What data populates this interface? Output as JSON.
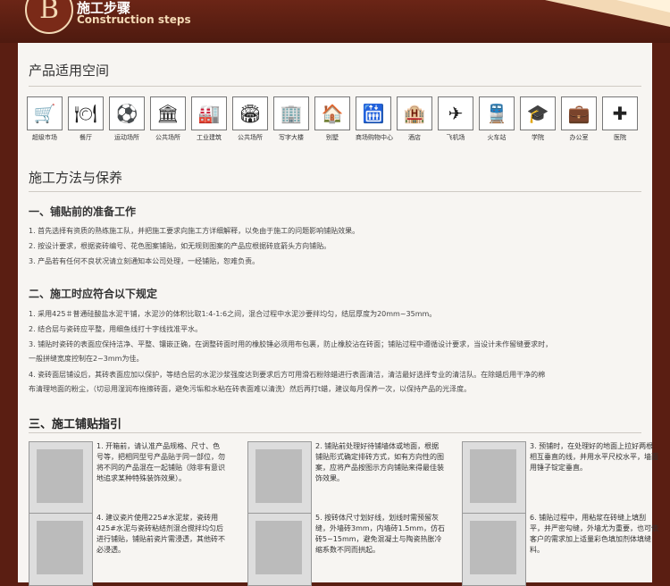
{
  "header": {
    "badge": "B",
    "title": "施工步骤",
    "subtitle": "Construction steps"
  },
  "section1": {
    "title": "产品适用空间"
  },
  "icons": [
    {
      "label": "超级市场",
      "icon": "cart-icon",
      "glyph": "🛒"
    },
    {
      "label": "餐厅",
      "icon": "restaurant-icon",
      "glyph": "🍽"
    },
    {
      "label": "运动场所",
      "icon": "sports-icon",
      "glyph": "⚽"
    },
    {
      "label": "公共场所",
      "icon": "public-building-icon",
      "glyph": "🏛"
    },
    {
      "label": "工业建筑",
      "icon": "factory-icon",
      "glyph": "🏭"
    },
    {
      "label": "公共场所",
      "icon": "stadium-icon",
      "glyph": "🏟"
    },
    {
      "label": "写字大楼",
      "icon": "office-tower-icon",
      "glyph": "🏢"
    },
    {
      "label": "别墅",
      "icon": "villa-icon",
      "glyph": "🏠"
    },
    {
      "label": "商场购物中心",
      "icon": "escalator-icon",
      "glyph": "🛗"
    },
    {
      "label": "酒店",
      "icon": "hotel-icon",
      "glyph": "🏨"
    },
    {
      "label": "飞机场",
      "icon": "airport-icon",
      "glyph": "✈"
    },
    {
      "label": "火车站",
      "icon": "train-icon",
      "glyph": "🚆"
    },
    {
      "label": "学院",
      "icon": "school-icon",
      "glyph": "🎓"
    },
    {
      "label": "办公室",
      "icon": "office-desk-icon",
      "glyph": "💼"
    },
    {
      "label": "医院",
      "icon": "hospital-icon",
      "glyph": "✚"
    }
  ],
  "section2": {
    "title": "施工方法与保养"
  },
  "prep": {
    "title": "一、铺贴前的准备工作",
    "lines": [
      "1. 首先选择有资质的熟练施工队，并把施工要求向施工方详细解释，以免由于施工的问题影响铺贴效果。",
      "2. 按设计要求，根据瓷砖编号、花色图案铺贴，如无规则图案的产品应根据砖底箭头方向铺贴。",
      "3. 产品若有任何不良状况请立刻通知本公司处理，一经铺贴，恕难负责。"
    ]
  },
  "construction": {
    "title": "二、施工时应符合以下规定",
    "lines": [
      "1. 采用425＃普通硅酸盐水泥干铺，水泥沙的体积比取1:4-1:6之间，混合过程中水泥沙要拌均匀，结层厚度为20mm~35mm。",
      "2. 结合层与瓷砖应平整，用细鱼线打十字线找准平水。",
      "3. 铺贴时瓷砖的表面应保持洁净、平整、镶嵌正确，在调整砖面时用的橡胶锤必须用布包裹，防止橡胶沾在砖面；铺贴过程中遵循设计要求，当设计未作留缝要求时，",
      "   一般拼缝宽度控制在2~3mm为佳。",
      "4. 瓷砖面层铺设后，其砖表面应加以保护，等结合层的水泥沙浆强度达到要求后方可用滑石粉除蜡进行表面清洁，清洁最好选择专业的清洁队。在除蜡后用干净的棉",
      "   布清理地面的粉尘，（切忌用湿润布拖擦砖面，避免污垢和水粘在砖表面难以清洗）然后再打t蜡，建议每月保养一次，以保持产品的光泽度。"
    ]
  },
  "guide": {
    "title": "三、施工铺贴指引"
  },
  "steps": [
    {
      "text": "1. 开箱前，请认准产品规格、尺寸、色号等，把相同型号产品贴于同一部位，勿将不同的产品混在一起铺贴（除非有意识地追求某种特殊装饰效果）。"
    },
    {
      "text": "2. 铺贴前处理好待铺墙体或地面，根据铺贴形式确定排砖方式，如有方向性的图案，应将产品按图示方向铺贴来得最佳装饰效果。"
    },
    {
      "text": "3. 预铺时，在处理好的地面上拉好两根相互垂直的线，并用水平尺校水平，墙面用锤子锭定垂直。"
    },
    {
      "text": "4. 建议瓷片使用225#水泥浆，瓷砖用425#水泥与瓷砖粘结剂混合搅拌均匀后进行铺贴，铺贴前瓷片需浸透，其他砖不必浸透。"
    },
    {
      "text": "5. 按砖体尺寸划好线，划线时需预留灰缝，外墙砖3mm，内墙砖1.5mm，仿石砖5~15mm，避免混凝土与陶瓷热胀冷缩系数不同而拱起。"
    },
    {
      "text": "6. 铺贴过程中，用粘浆在砖缝上填刮平，并严密勾缝，外墙尤为重要，也可依客户的需求加上适量彩色填加剂体填缝料。"
    }
  ]
}
